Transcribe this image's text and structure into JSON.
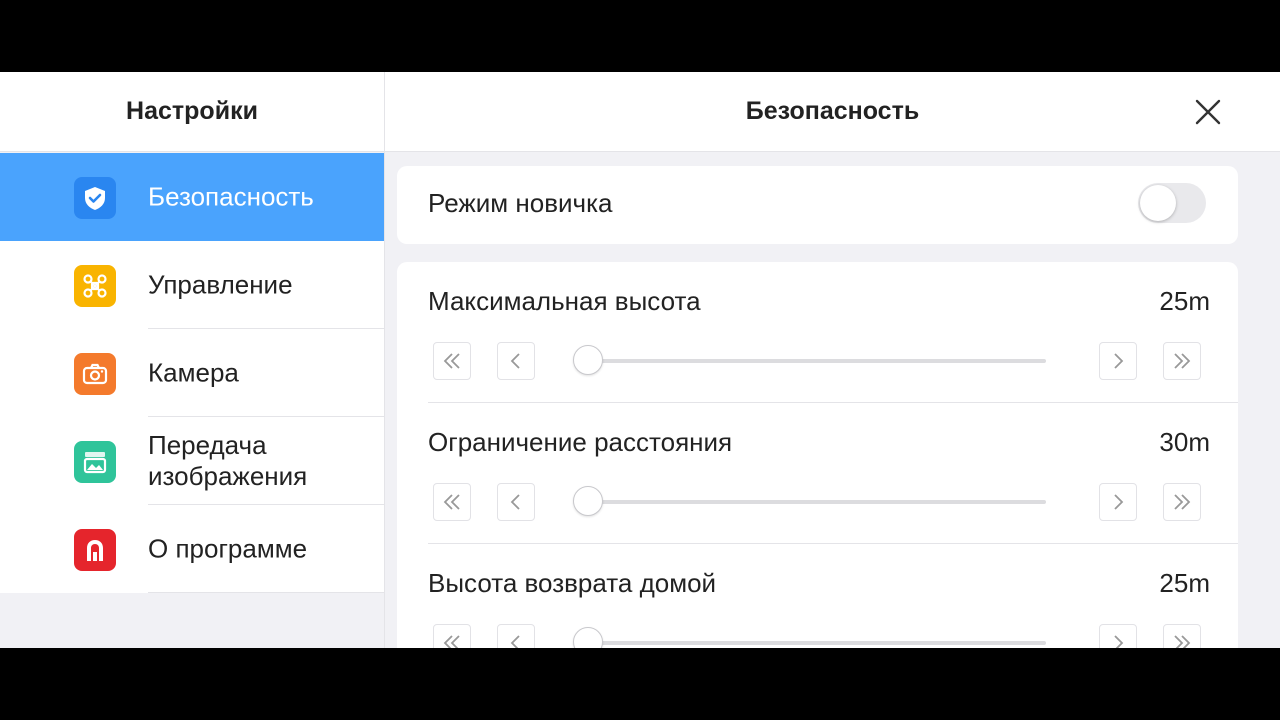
{
  "sidebar": {
    "title": "Настройки",
    "items": [
      {
        "label": "Безопасность",
        "icon": "shield-check-icon",
        "color": "#2a86f0",
        "active": true
      },
      {
        "label": "Управление",
        "icon": "drone-icon",
        "color": "#f9b400"
      },
      {
        "label": "Камера",
        "icon": "camera-icon",
        "color": "#f47a2c"
      },
      {
        "label": "Передача изображения",
        "icon": "image-icon",
        "color": "#2fc49a"
      },
      {
        "label": "О программе",
        "icon": "app-logo-icon",
        "color": "#e5252c"
      }
    ]
  },
  "panel": {
    "title": "Безопасность",
    "close_icon": "close-icon",
    "novice_mode": {
      "label": "Режим новичка",
      "enabled": false
    },
    "sliders": [
      {
        "label": "Максимальная высота",
        "value": "25m",
        "position": 0
      },
      {
        "label": "Ограничение расстояния",
        "value": "30m",
        "position": 0
      },
      {
        "label": "Высота возврата домой",
        "value": "25m",
        "position": 0
      }
    ]
  },
  "colors": {
    "accent": "#4aa3fd",
    "background": "#f1f1f5",
    "text": "#222222"
  }
}
